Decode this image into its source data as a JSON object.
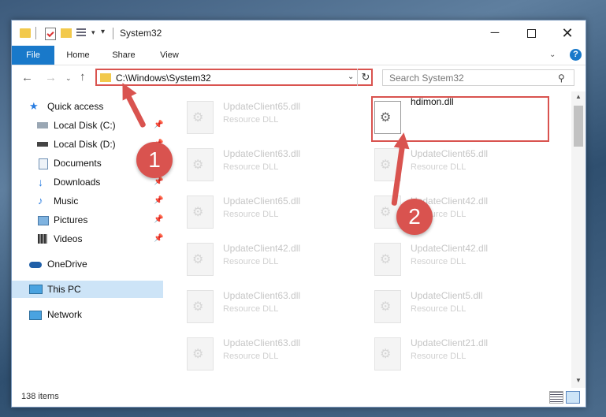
{
  "window": {
    "title": "System32"
  },
  "ribbon": {
    "tabs": [
      "File",
      "Home",
      "Share",
      "View"
    ]
  },
  "address": {
    "path": "C:\\Windows\\System32",
    "search_placeholder": "Search System32"
  },
  "sidebar": {
    "items": [
      {
        "label": "Quick access",
        "icon": "star-icon",
        "pinned": false
      },
      {
        "label": "Local Disk (C:)",
        "icon": "drive-icon",
        "pinned": true
      },
      {
        "label": "Local Disk (D:)",
        "icon": "drive-icon",
        "pinned": true
      },
      {
        "label": "Documents",
        "icon": "documents-icon",
        "pinned": true
      },
      {
        "label": "Downloads",
        "icon": "download-icon",
        "pinned": true
      },
      {
        "label": "Music",
        "icon": "music-icon",
        "pinned": true
      },
      {
        "label": "Pictures",
        "icon": "pictures-icon",
        "pinned": true
      },
      {
        "label": "Videos",
        "icon": "videos-icon",
        "pinned": true
      },
      {
        "label": "OneDrive",
        "icon": "cloud-icon",
        "pinned": false
      },
      {
        "label": "This PC",
        "icon": "computer-icon",
        "pinned": false,
        "selected": true
      },
      {
        "label": "Network",
        "icon": "network-icon",
        "pinned": false
      }
    ]
  },
  "files": {
    "left": [
      {
        "name": "UpdateClient65.dll",
        "type": "Resource DLL"
      },
      {
        "name": "UpdateClient63.dll",
        "type": "Resource DLL"
      },
      {
        "name": "UpdateClient65.dll",
        "type": "Resource DLL"
      },
      {
        "name": "UpdateClient42.dll",
        "type": "Resource DLL"
      },
      {
        "name": "UpdateClient63.dll",
        "type": "Resource DLL"
      },
      {
        "name": "UpdateClient63.dll",
        "type": "Resource DLL"
      }
    ],
    "right": [
      {
        "name": "hdimon.dll",
        "type": "",
        "active": true
      },
      {
        "name": "UpdateClient65.dll",
        "type": "Resource DLL"
      },
      {
        "name": "UpdateClient42.dll",
        "type": "Resource DLL"
      },
      {
        "name": "UpdateClient42.dll",
        "type": "Resource DLL"
      },
      {
        "name": "UpdateClient5.dll",
        "type": "Resource DLL"
      },
      {
        "name": "UpdateClient21.dll",
        "type": "Resource DLL"
      }
    ]
  },
  "status": {
    "count": "138 items"
  },
  "annotations": {
    "step1": "1",
    "step2": "2"
  },
  "colors": {
    "accent": "#1979ca",
    "annotation": "#d9534f",
    "selected": "#cde4f7"
  }
}
